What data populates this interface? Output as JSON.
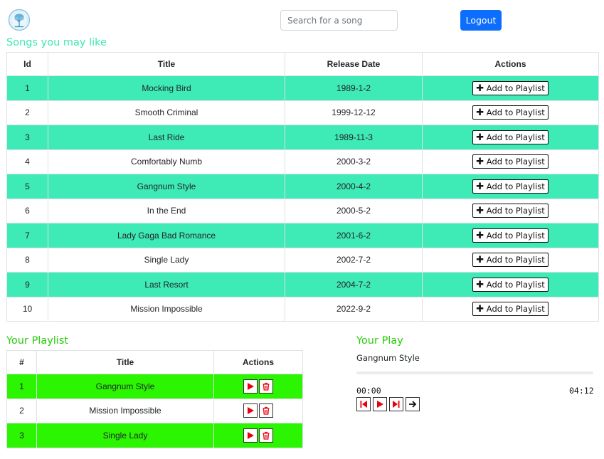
{
  "header": {
    "search_placeholder": "Search for a song",
    "logout_label": "Logout"
  },
  "songs": {
    "heading": "Songs you may like",
    "columns": [
      "Id",
      "Title",
      "Release Date",
      "Actions"
    ],
    "add_label": "Add to Playlist",
    "rows": [
      {
        "id": "1",
        "title": "Mocking Bird",
        "date": "1989-1-2"
      },
      {
        "id": "2",
        "title": "Smooth Criminal",
        "date": "1999-12-12"
      },
      {
        "id": "3",
        "title": "Last Ride",
        "date": "1989-11-3"
      },
      {
        "id": "4",
        "title": "Comfortably Numb",
        "date": "2000-3-2"
      },
      {
        "id": "5",
        "title": "Gangnum Style",
        "date": "2000-4-2"
      },
      {
        "id": "6",
        "title": "In the End",
        "date": "2000-5-2"
      },
      {
        "id": "7",
        "title": "Lady Gaga Bad Romance",
        "date": "2001-6-2"
      },
      {
        "id": "8",
        "title": "Single Lady",
        "date": "2002-7-2"
      },
      {
        "id": "9",
        "title": "Last Resort",
        "date": "2004-7-2"
      },
      {
        "id": "10",
        "title": "Mission Impossible",
        "date": "2022-9-2"
      }
    ]
  },
  "playlist": {
    "heading": "Your Playlist",
    "columns": [
      "#",
      "Title",
      "Actions"
    ],
    "rows": [
      {
        "num": "1",
        "title": "Gangnum Style"
      },
      {
        "num": "2",
        "title": "Mission Impossible"
      },
      {
        "num": "3",
        "title": "Single Lady"
      }
    ]
  },
  "player": {
    "heading": "Your Play",
    "current_song": "Gangnum Style",
    "current_time": "00:00",
    "duration": "04:12",
    "progress": 0
  },
  "colors": {
    "songs_row_highlight": "#3eeab6",
    "playlist_row_highlight": "#2bf500",
    "logout_button": "#0d6efd",
    "control_icon": "#e8000b"
  },
  "icons": {
    "logo": "tree-logo-icon",
    "add": "plus-icon",
    "play": "play-icon",
    "delete": "trash-icon",
    "previous": "skip-previous-icon",
    "next": "skip-next-icon",
    "forward": "arrow-right-icon"
  }
}
